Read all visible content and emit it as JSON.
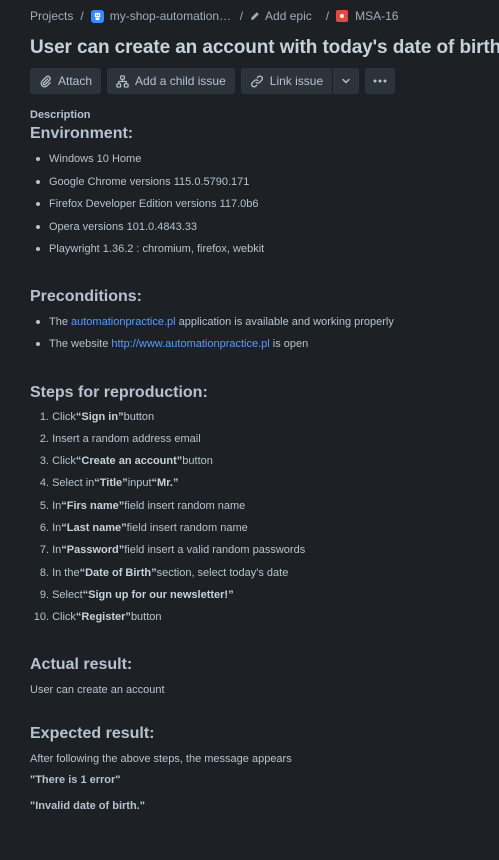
{
  "breadcrumb": {
    "projects": "Projects",
    "project": "my-shop-automationpr...",
    "add_epic": "Add epic",
    "issue_key": "MSA-16",
    "separator": "/"
  },
  "title": "User can create an account with today's date of birth",
  "toolbar": {
    "attach": "Attach",
    "add_child": "Add a child issue",
    "link_issue": "Link issue"
  },
  "description_label": "Description",
  "environment": {
    "heading": "Environment:",
    "items": [
      "Windows 10 Home",
      "Google Chrome versions 115.0.5790.171",
      "Firefox Developer Edition versions 117.0b6",
      "Opera versions 101.0.4843.33",
      "Playwright 1.36.2 : chromium, firefox, webkit"
    ]
  },
  "preconditions": {
    "heading": "Preconditions:",
    "item1_pre": "The ",
    "item1_link": "automationpractice.pl",
    "item1_post": " application is available and working properly",
    "item2_pre": "The website ",
    "item2_link": "http://www.automationpractice.pl",
    "item2_post": " is open"
  },
  "steps": {
    "heading": "Steps for reproduction:",
    "s1_pre": "Click ",
    "s1_b": "“Sign in”",
    "s1_post": " button",
    "s2": "Insert a random address email",
    "s3_pre": "Click ",
    "s3_b": "“Create an account”",
    "s3_post": " button",
    "s4_pre": "Select in ",
    "s4_b": "“Title”",
    "s4_mid": " input ",
    "s4_b2": "“Mr.”",
    "s5_pre": "In ",
    "s5_b": "“Firs name”",
    "s5_post": " field insert random name",
    "s6_pre": "In ",
    "s6_b": "“Last name”",
    "s6_post": " field insert random name",
    "s7_pre": "In ",
    "s7_b": "“Password”",
    "s7_post": " field insert a valid random passwords",
    "s8_pre": "In the ",
    "s8_b": "“Date of Birth”",
    "s8_post": " section, select today's date",
    "s9_pre": "Select ",
    "s9_b": "“Sign up for our newsletter!”",
    "s10_pre": "Click ",
    "s10_b": "“Register”",
    "s10_post": " button",
    "numbers": [
      "1.",
      "2.",
      "3.",
      "4.",
      "5.",
      "6.",
      "7.",
      "8.",
      "9.",
      "10."
    ]
  },
  "actual": {
    "heading": "Actual result:",
    "text": "User can create an account"
  },
  "expected": {
    "heading": "Expected result:",
    "text": "After following the above steps, the message appears",
    "msg1": "\"There is 1 error\"",
    "msg2": "\"Invalid date of birth.\""
  }
}
